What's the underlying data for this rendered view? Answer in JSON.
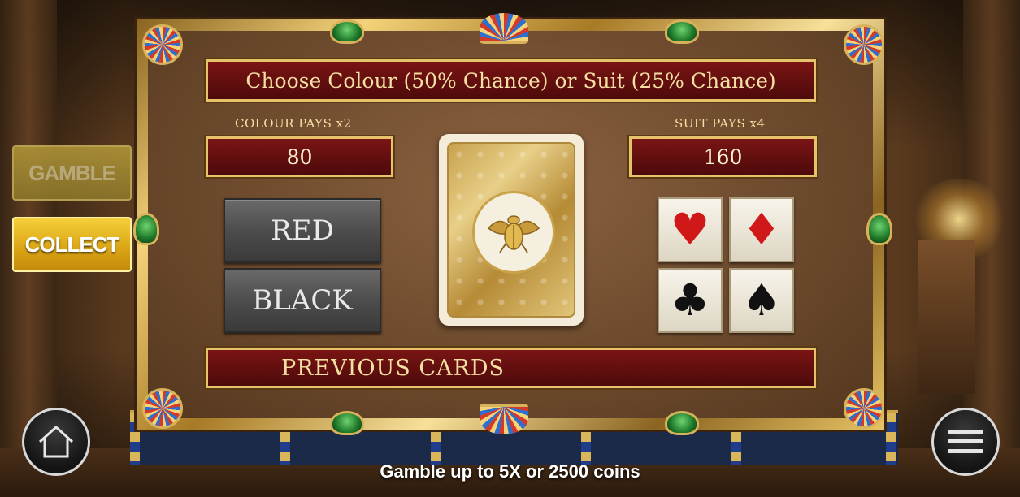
{
  "title": "Choose Colour (50% Chance) or Suit (25% Chance)",
  "colour": {
    "pays_label": "COLOUR PAYS x2",
    "value": "80"
  },
  "suit": {
    "pays_label": "SUIT PAYS x4",
    "value": "160"
  },
  "buttons": {
    "red": "RED",
    "black": "BLACK"
  },
  "suits": [
    {
      "name": "hearts",
      "symbol": "♥",
      "color": "#d01818"
    },
    {
      "name": "diamonds",
      "symbol": "♦",
      "color": "#d01818"
    },
    {
      "name": "clubs",
      "symbol": "♣",
      "color": "#111111"
    },
    {
      "name": "spades",
      "symbol": "♠",
      "color": "#111111"
    }
  ],
  "previous_cards_label": "PREVIOUS CARDS",
  "side_buttons": {
    "gamble": "GAMBLE",
    "collect": "COLLECT"
  },
  "footer": "Gamble up to 5X or 2500 coins",
  "icons": {
    "home": "home-icon",
    "menu": "hamburger-menu-icon",
    "card_back": "scarab-icon"
  },
  "colors": {
    "banner": "#7a1414",
    "gold": "#e6c36a",
    "collect": "#f6cf3a"
  }
}
